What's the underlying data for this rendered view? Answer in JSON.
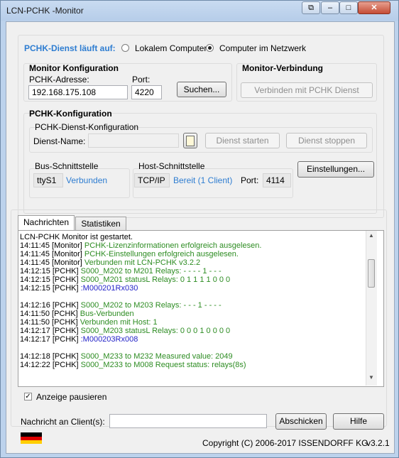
{
  "window": {
    "title": "LCN-PCHK -Monitor"
  },
  "service": {
    "label": "PCHK-Dienst läuft auf:",
    "options": [
      "Lokalem Computer",
      "Computer im Netzwerk"
    ],
    "selected": "Computer im Netzwerk"
  },
  "monitor_config": {
    "title": "Monitor Konfiguration",
    "address_label": "PCHK-Adresse:",
    "address_value": "192.168.175.108",
    "port_label": "Port:",
    "port_value": "4220",
    "search_button": "Suchen..."
  },
  "monitor_connection": {
    "title": "Monitor-Verbindung",
    "connect_button": "Verbinden mit PCHK Dienst"
  },
  "pchk_config": {
    "title": "PCHK-Konfiguration",
    "service_config_title": "PCHK-Dienst-Konfiguration",
    "service_name_label": "Dienst-Name:",
    "service_name_value": "",
    "start_button": "Dienst starten",
    "stop_button": "Dienst stoppen",
    "bus_title": "Bus-Schnittstelle",
    "bus_port": "ttyS1",
    "bus_status": "Verbunden",
    "host_title": "Host-Schnittstelle",
    "host_protocol": "TCP/IP",
    "host_status": "Bereit (1 Client)",
    "host_port_label": "Port:",
    "host_port_value": "4114",
    "settings_button": "Einstellungen..."
  },
  "tabs": [
    "Nachrichten",
    "Statistiken"
  ],
  "log": [
    {
      "t": "LCN-PCHK  Monitor ist gestartet.",
      "c": "plain"
    },
    {
      "p": "14:11:45 [Monitor] ",
      "m": "PCHK-Lizenzinformationen erfolgreich ausgelesen.",
      "c": "green"
    },
    {
      "p": "14:11:45 [Monitor] ",
      "m": "PCHK-Einstellungen erfolgreich ausgelesen.",
      "c": "green"
    },
    {
      "p": "14:11:45 [Monitor] ",
      "m": "Verbunden mit LCN-PCHK v3.2.2",
      "c": "green"
    },
    {
      "p": "14:12:15 [PCHK] ",
      "m": "S000_M202 to M201 Relays: - - - -   1 - - -",
      "c": "green"
    },
    {
      "p": "14:12:15 [PCHK] ",
      "m": "S000_M201 statusL Relays: 0 1 1 1  1 0 0 0",
      "c": "green"
    },
    {
      "p": "14:12:15 [PCHK] ",
      "m": ":M000201Rx030",
      "c": "blue"
    },
    {
      "t": "",
      "c": "plain"
    },
    {
      "p": "14:12:16 [PCHK] ",
      "m": "S000_M202 to M203 Relays: - - - 1   - - - -",
      "c": "green"
    },
    {
      "p": "14:11:50 [PCHK] ",
      "m": "Bus-Verbunden",
      "c": "green"
    },
    {
      "p": "14:11:50 [PCHK] ",
      "m": "Verbunden mit Host: 1",
      "c": "green"
    },
    {
      "p": "14:12:17 [PCHK] ",
      "m": "S000_M203 statusL Relays: 0 0 0 1  0 0 0 0",
      "c": "green"
    },
    {
      "p": "14:12:17 [PCHK] ",
      "m": ":M000203Rx008",
      "c": "blue"
    },
    {
      "t": "",
      "c": "plain"
    },
    {
      "p": "14:12:18 [PCHK] ",
      "m": "S000_M233 to M232 Measured value: 2049",
      "c": "green"
    },
    {
      "p": "14:12:22 [PCHK] ",
      "m": "S000_M233 to M008 Request status: relays(8s)",
      "c": "green"
    }
  ],
  "pause": {
    "label": "Anzeige pausieren",
    "checked": true
  },
  "message": {
    "label": "Nachricht an Client(s):",
    "value": "",
    "send_button": "Abschicken",
    "help_button": "Hilfe"
  },
  "footer": {
    "copyright": "Copyright (C) 2006-2017 ISSENDORFF KG",
    "version": "v3.2.1",
    "flag_icon": "german-flag-icon"
  },
  "colors": {
    "status_blue": "#2e7dd1",
    "log_green": "#2d8c22",
    "log_blue": "#2323c8",
    "title_blue": "#2e7dd1"
  }
}
